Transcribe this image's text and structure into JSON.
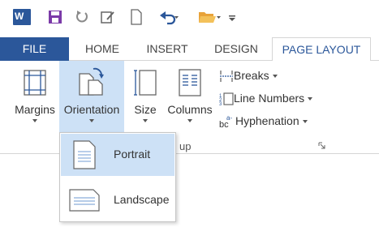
{
  "tabs": [
    {
      "label": "FILE"
    },
    {
      "label": "HOME"
    },
    {
      "label": "INSERT"
    },
    {
      "label": "DESIGN"
    },
    {
      "label": "PAGE LAYOUT"
    }
  ],
  "ribbon": {
    "margins": "Margins",
    "orientation": "Orientation",
    "size": "Size",
    "columns": "Columns",
    "breaks": "Breaks",
    "line_numbers": "Line Numbers",
    "hyphenation": "Hyphenation",
    "group_label_fragment": "up"
  },
  "orientation_menu": {
    "items": [
      {
        "label": "Portrait"
      },
      {
        "label": "Landscape"
      }
    ]
  },
  "colors": {
    "accent": "#2b579a",
    "hover": "#cde1f6"
  }
}
